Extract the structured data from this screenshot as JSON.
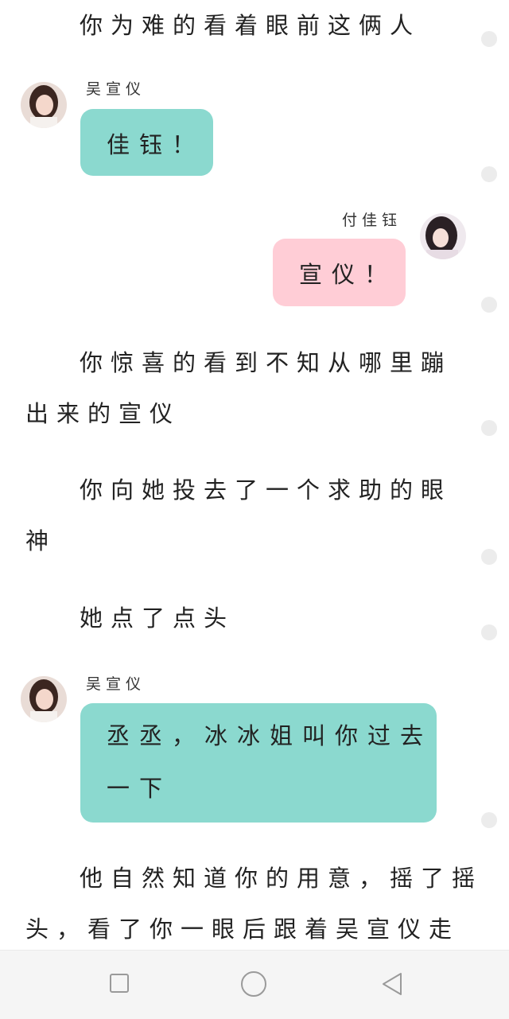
{
  "narration": {
    "line1": "你为难的看着眼前这俩人",
    "para2_line1": "你惊喜的看到不知从哪里蹦",
    "para2_line2": "出来的宣仪",
    "para3_line1": "你向她投去了一个求助的眼",
    "para3_line2": "神",
    "para4": "她点了点头",
    "para5_line1": "他自然知道你的用意，摇了摇",
    "para5_line2": "头，看了你一眼后跟着吴宣仪走"
  },
  "messages": [
    {
      "sender": "吴宣仪",
      "text": "佳钰！",
      "side": "left",
      "color": "#8bd9cf"
    },
    {
      "sender": "付佳钰",
      "text": "宣仪！",
      "side": "right",
      "color": "#ffcdd6"
    },
    {
      "sender": "吴宣仪",
      "text_line1": "丞丞，冰冰姐叫你过去",
      "text_line2": "一下",
      "side": "left",
      "color": "#8bd9cf"
    }
  ],
  "navbar": {
    "icons": [
      "square-recent-apps-icon",
      "circle-home-icon",
      "triangle-back-icon"
    ]
  }
}
